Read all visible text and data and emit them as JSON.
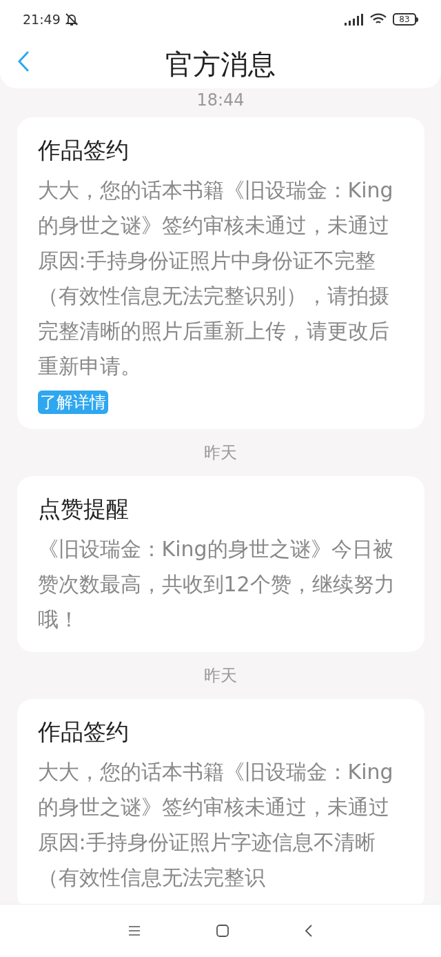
{
  "status_bar": {
    "time": "21:49",
    "battery": "83"
  },
  "header": {
    "title": "官方消息"
  },
  "messages": [
    {
      "time": "18:44",
      "title": "作品签约",
      "body": "大大，您的话本书籍《旧设瑞金：King的身世之谜》签约审核未通过，未通过原因:手持身份证照片中身份证不完整（有效性信息无法完整识别），请拍摄完整清晰的照片后重新上传，请更改后重新申请。",
      "link": "了解详情"
    },
    {
      "time": "昨天",
      "title": "点赞提醒",
      "body": "《旧设瑞金：King的身世之谜》今日被赞次数最高，共收到12个赞，继续努力哦！"
    },
    {
      "time": "昨天",
      "title": "作品签约",
      "body": "大大，您的话本书籍《旧设瑞金：King的身世之谜》签约审核未通过，未通过原因:手持身份证照片字迹信息不清晰（有效性信息无法完整识"
    }
  ]
}
